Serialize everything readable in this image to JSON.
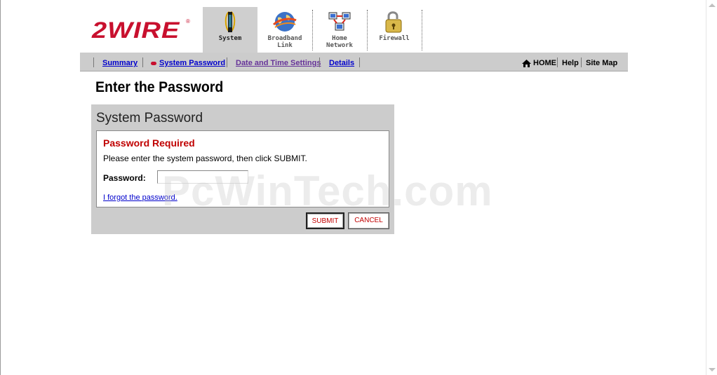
{
  "brand": {
    "logo_text": "2WIRE",
    "reg_mark": "®",
    "accent": "#c8102e"
  },
  "tabs": [
    {
      "id": "system",
      "label": "System",
      "icon": "system-tower-icon",
      "active": true
    },
    {
      "id": "broadband",
      "label": "Broadband\nLink",
      "icon": "globe-icon",
      "active": false
    },
    {
      "id": "home-network",
      "label": "Home\nNetwork",
      "icon": "network-computers-icon",
      "active": false
    },
    {
      "id": "firewall",
      "label": "Firewall",
      "icon": "padlock-icon",
      "active": false
    }
  ],
  "subnav": {
    "summary": "Summary",
    "system_password": "System Password",
    "date_time": "Date and Time Settings",
    "details": "Details"
  },
  "util": {
    "home": "HOME",
    "help": "Help",
    "site_map": "Site Map"
  },
  "page_title": "Enter the Password",
  "panel": {
    "title": "System Password",
    "required_title": "Password Required",
    "instructions": "Please enter the system password, then click SUBMIT.",
    "password_label": "Password:",
    "password_value": "",
    "forgot_link": "I forgot the password.",
    "submit_label": "SUBMIT",
    "cancel_label": "CANCEL"
  },
  "watermark": "PcWinTech.com"
}
